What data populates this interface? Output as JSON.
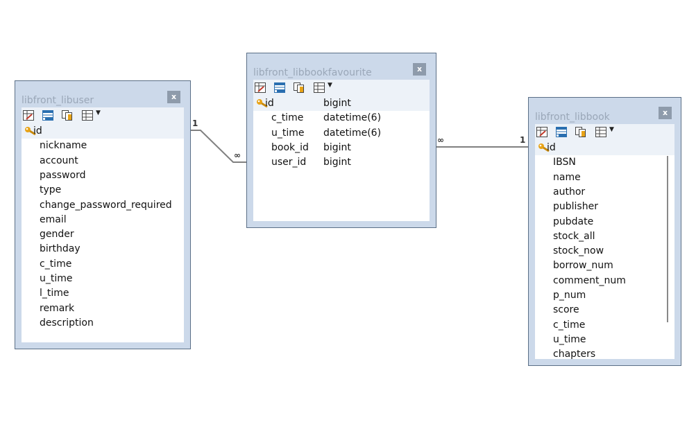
{
  "tables": {
    "libuser": {
      "title": "libfront_libuser",
      "close_label": "x",
      "fields": [
        "id",
        "nickname",
        "account",
        "password",
        "type",
        "change_password_required",
        "email",
        "gender",
        "birthday",
        "c_time",
        "u_time",
        "l_time",
        "remark",
        "description"
      ]
    },
    "favourite": {
      "title": "libfront_libbookfavourite",
      "close_label": "x",
      "fields": [
        {
          "name": "id",
          "type": "bigint"
        },
        {
          "name": "c_time",
          "type": "datetime(6)"
        },
        {
          "name": "u_time",
          "type": "datetime(6)"
        },
        {
          "name": "book_id",
          "type": "bigint"
        },
        {
          "name": "user_id",
          "type": "bigint"
        }
      ]
    },
    "libbook": {
      "title": "libfront_libbook",
      "close_label": "x",
      "fields": [
        "id",
        "IBSN",
        "name",
        "author",
        "publisher",
        "pubdate",
        "stock_all",
        "stock_now",
        "borrow_num",
        "comment_num",
        "p_num",
        "score",
        "c_time",
        "u_time",
        "chapters"
      ]
    }
  },
  "relations": {
    "user_fav": {
      "from_card": "1",
      "to_card": "∞"
    },
    "fav_book": {
      "from_card": "∞",
      "to_card": "1"
    }
  },
  "colors": {
    "window_frame": "#ccd9ea",
    "pk_row": "#edf2f8",
    "title_text": "#9aa7b8",
    "close_button": "#8e9bab",
    "connector": "#808080",
    "key_icon": "#e8a317"
  },
  "icons": {
    "toolbar": [
      "edit-table-icon",
      "fields-list-icon",
      "copy-icon",
      "grid-view-icon",
      "chevron-down-icon"
    ],
    "primary_key": "key-icon"
  }
}
